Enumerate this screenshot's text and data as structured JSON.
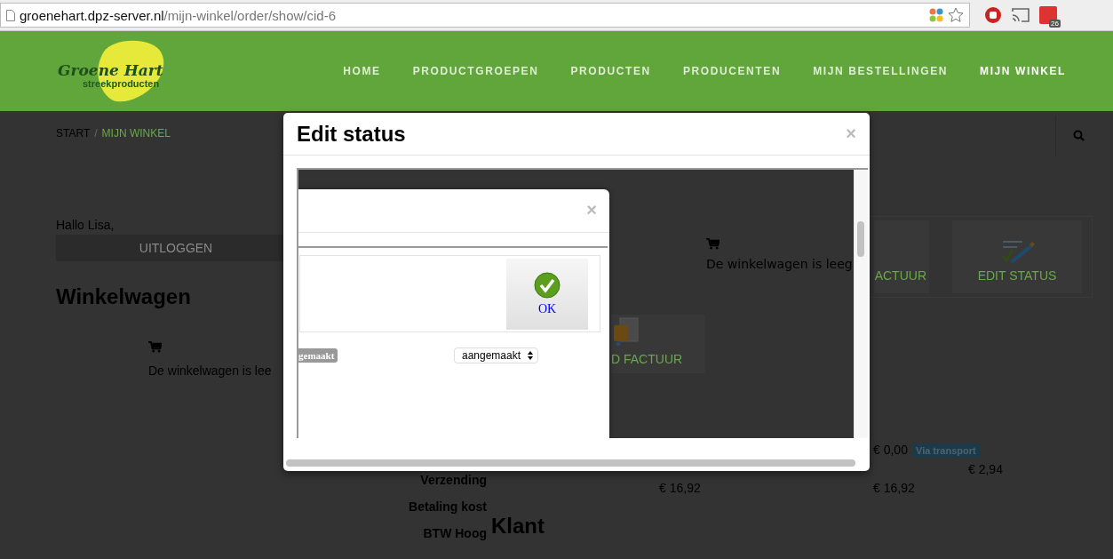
{
  "browser": {
    "url_host": "groenehart.dpz-server.nl",
    "url_path": "/mijn-winkel/order/show/cid-6",
    "extension_badge": "26"
  },
  "site": {
    "logo_title": "Groene Hart",
    "logo_subtitle": "streekproducten",
    "nav": [
      {
        "label": "HOME",
        "selected": false
      },
      {
        "label": "PRODUCTGROEPEN",
        "selected": false
      },
      {
        "label": "PRODUCTEN",
        "selected": false
      },
      {
        "label": "PRODUCENTEN",
        "selected": false
      },
      {
        "label": "MIJN BESTELLINGEN",
        "selected": false
      },
      {
        "label": "MIJN WINKEL",
        "selected": true
      }
    ]
  },
  "breadcrumb": {
    "items": [
      {
        "label": "START",
        "selected": false
      },
      {
        "label": "MIJN WINKEL",
        "selected": true
      }
    ],
    "separator": "/"
  },
  "account": {
    "greeting": "Hallo Lisa,",
    "logout_button": "UITLOGGEN"
  },
  "cart": {
    "heading": "Winkelwagen",
    "empty_text": "De winkelwagen is lee"
  },
  "tiles": [
    {
      "label": "ACTUUR"
    },
    {
      "kind": "edit",
      "label": "EDIT STATUS"
    }
  ],
  "totals": {
    "labels": [
      "Verzending",
      "Betaling kost",
      "BTW Hoog"
    ],
    "shipping_amount": "€ 0,00",
    "shipping_badge": "Via transport",
    "payment_amount": "€ 2,94",
    "amounts": [
      "€ 16,92",
      "€ 16,92"
    ]
  },
  "customer_heading": "Klant",
  "modal": {
    "title": "Edit status",
    "close": "×",
    "frame": {
      "cart_empty_text": "De winkelwagen is leeg",
      "tile": {
        "kind": "invoice",
        "label": "D FACTUUR"
      },
      "dialog": {
        "close": "×",
        "ok_button": "OK",
        "status_badge": "gemaakt",
        "status_select": {
          "value": "aangemaakt"
        }
      }
    }
  }
}
